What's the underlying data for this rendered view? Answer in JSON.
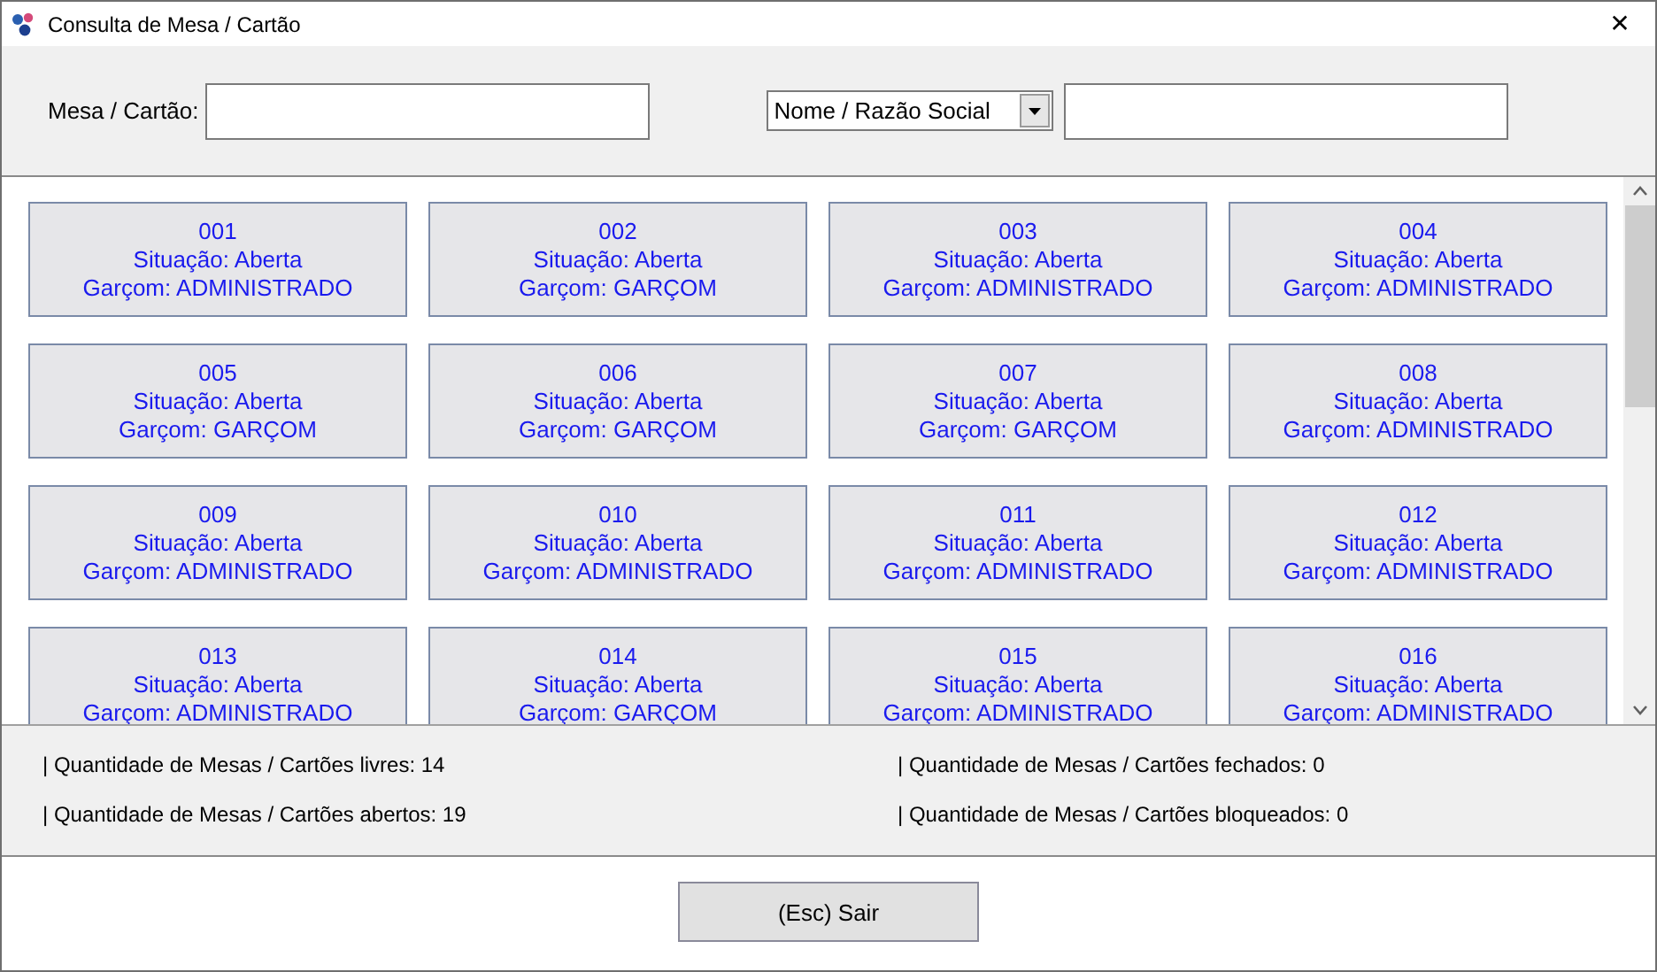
{
  "window": {
    "title": "Consulta de Mesa / Cartão",
    "close": "✕"
  },
  "search": {
    "label": "Mesa / Cartão:",
    "filter": "Nome / Razão Social"
  },
  "tables": [
    {
      "number": "001",
      "status": "Situação: Aberta",
      "waiter": "Garçom: ADMINISTRADO"
    },
    {
      "number": "002",
      "status": "Situação: Aberta",
      "waiter": "Garçom: GARÇOM"
    },
    {
      "number": "003",
      "status": "Situação: Aberta",
      "waiter": "Garçom: ADMINISTRADO"
    },
    {
      "number": "004",
      "status": "Situação: Aberta",
      "waiter": "Garçom: ADMINISTRADO"
    },
    {
      "number": "005",
      "status": "Situação: Aberta",
      "waiter": "Garçom: GARÇOM"
    },
    {
      "number": "006",
      "status": "Situação: Aberta",
      "waiter": "Garçom: GARÇOM"
    },
    {
      "number": "007",
      "status": "Situação: Aberta",
      "waiter": "Garçom: GARÇOM"
    },
    {
      "number": "008",
      "status": "Situação: Aberta",
      "waiter": "Garçom: ADMINISTRADO"
    },
    {
      "number": "009",
      "status": "Situação: Aberta",
      "waiter": "Garçom: ADMINISTRADO"
    },
    {
      "number": "010",
      "status": "Situação: Aberta",
      "waiter": "Garçom: ADMINISTRADO"
    },
    {
      "number": "011",
      "status": "Situação: Aberta",
      "waiter": "Garçom: ADMINISTRADO"
    },
    {
      "number": "012",
      "status": "Situação: Aberta",
      "waiter": "Garçom: ADMINISTRADO"
    },
    {
      "number": "013",
      "status": "Situação: Aberta",
      "waiter": "Garçom: ADMINISTRADO"
    },
    {
      "number": "014",
      "status": "Situação: Aberta",
      "waiter": "Garçom: GARÇOM"
    },
    {
      "number": "015",
      "status": "Situação: Aberta",
      "waiter": "Garçom: ADMINISTRADO"
    },
    {
      "number": "016",
      "status": "Situação: Aberta",
      "waiter": "Garçom: ADMINISTRADO"
    }
  ],
  "stats": [
    "| Quantidade de Mesas / Cartões livres: 14",
    "| Quantidade de Mesas / Cartões fechados: 0",
    "| Quantidade de Mesas / Cartões abertos: 19",
    "| Quantidade de Mesas / Cartões bloqueados: 0"
  ],
  "exit_button": "(Esc) Sair"
}
